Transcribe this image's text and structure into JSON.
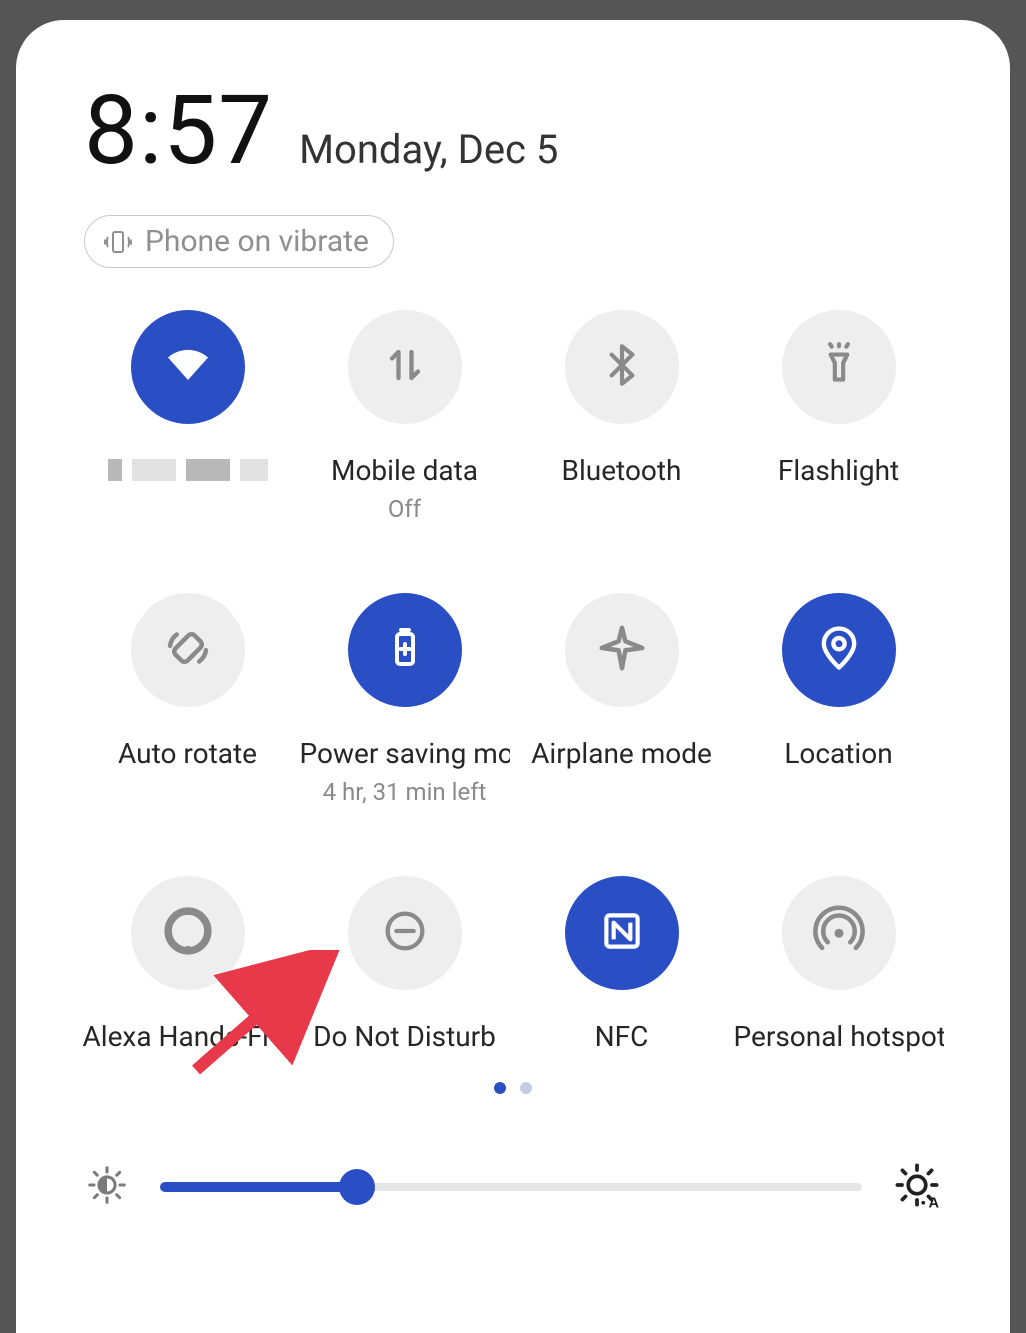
{
  "header": {
    "time": "8:57",
    "date": "Monday, Dec 5"
  },
  "status": {
    "label": "Phone on vibrate"
  },
  "tiles": [
    {
      "id": "wifi",
      "label": "",
      "sub": "",
      "active": true,
      "icon": "wifi"
    },
    {
      "id": "mobile-data",
      "label": "Mobile data",
      "sub": "Off",
      "active": false,
      "icon": "data"
    },
    {
      "id": "bluetooth",
      "label": "Bluetooth",
      "sub": "",
      "active": false,
      "icon": "bluetooth"
    },
    {
      "id": "flashlight",
      "label": "Flashlight",
      "sub": "",
      "active": false,
      "icon": "flashlight"
    },
    {
      "id": "auto-rotate",
      "label": "Auto rotate",
      "sub": "",
      "active": false,
      "icon": "rotate"
    },
    {
      "id": "power-saving",
      "label": "Power saving mode",
      "sub": "4 hr, 31 min left",
      "active": true,
      "icon": "battery"
    },
    {
      "id": "airplane-mode",
      "label": "Airplane mode",
      "sub": "",
      "active": false,
      "icon": "airplane"
    },
    {
      "id": "location",
      "label": "Location",
      "sub": "",
      "active": true,
      "icon": "location"
    },
    {
      "id": "alexa",
      "label": "Alexa Hands-Free",
      "sub": "",
      "active": false,
      "icon": "alexa"
    },
    {
      "id": "dnd",
      "label": "Do Not Disturb",
      "sub": "",
      "active": false,
      "icon": "dnd"
    },
    {
      "id": "nfc",
      "label": "NFC",
      "sub": "",
      "active": true,
      "icon": "nfc"
    },
    {
      "id": "hotspot",
      "label": "Personal hotspot",
      "sub": "",
      "active": false,
      "icon": "hotspot"
    }
  ],
  "pager": {
    "pages": 2,
    "active": 0
  },
  "brightness": {
    "percent": 28
  },
  "colors": {
    "accent": "#2a4fc5"
  },
  "annotation": {
    "arrow_target": "dnd"
  }
}
